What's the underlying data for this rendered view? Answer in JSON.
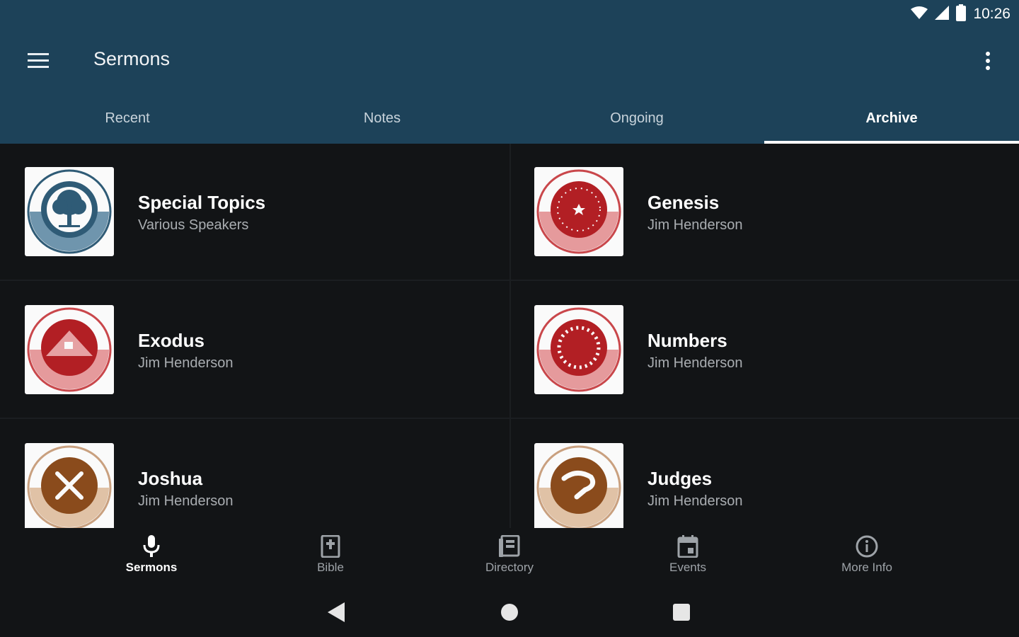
{
  "status": {
    "time": "10:26"
  },
  "appbar": {
    "title": "Sermons"
  },
  "tabs": [
    {
      "label": "Recent",
      "active": false
    },
    {
      "label": "Notes",
      "active": false
    },
    {
      "label": "Ongoing",
      "active": false
    },
    {
      "label": "Archive",
      "active": true
    }
  ],
  "series": [
    {
      "title": "Special Topics",
      "speaker": "Various Speakers",
      "icon": "tree-icon",
      "color": "#2f5b76"
    },
    {
      "title": "Genesis",
      "speaker": "Jim Henderson",
      "icon": "star-of-creation-icon",
      "color": "#b21f24"
    },
    {
      "title": "Exodus",
      "speaker": "Jim Henderson",
      "icon": "mountain-icon",
      "color": "#b21f24"
    },
    {
      "title": "Numbers",
      "speaker": "Jim Henderson",
      "icon": "numbers-circle-icon",
      "color": "#b21f24"
    },
    {
      "title": "Joshua",
      "speaker": "Jim Henderson",
      "icon": "crossed-swords-icon",
      "color": "#8a4b1c"
    },
    {
      "title": "Judges",
      "speaker": "Jim Henderson",
      "icon": "horn-icon",
      "color": "#8a4b1c"
    }
  ],
  "bottom_nav": [
    {
      "label": "Sermons",
      "icon": "microphone-icon",
      "active": true
    },
    {
      "label": "Bible",
      "icon": "bible-icon",
      "active": false
    },
    {
      "label": "Directory",
      "icon": "directory-icon",
      "active": false
    },
    {
      "label": "Events",
      "icon": "calendar-icon",
      "active": false
    },
    {
      "label": "More Info",
      "icon": "info-icon",
      "active": false
    }
  ],
  "colors": {
    "primary": "#1d4259",
    "background": "#121416",
    "subtitle": "#a9adb1"
  }
}
